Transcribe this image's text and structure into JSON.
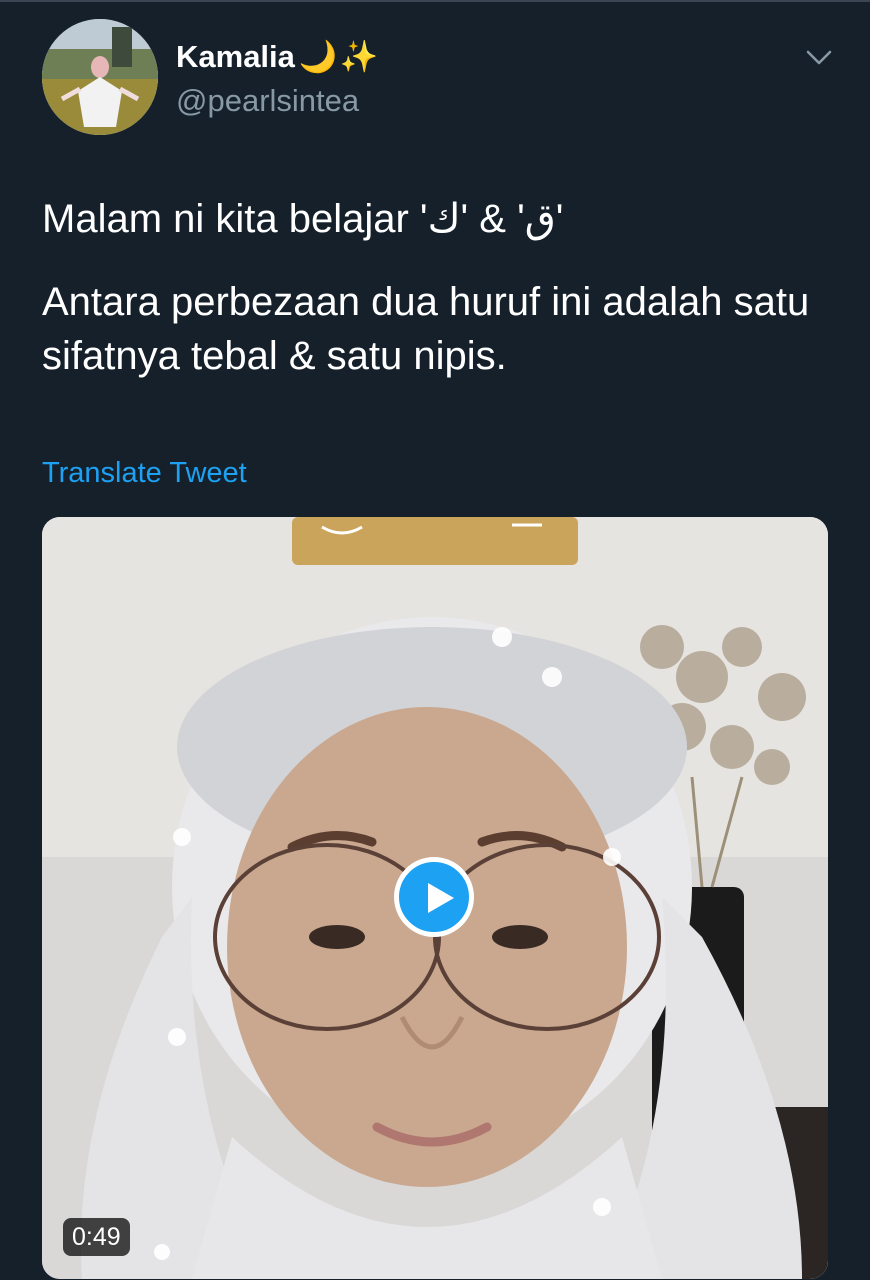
{
  "tweet": {
    "author": {
      "display_name": "Kamalia",
      "name_emoji_moon": "🌙",
      "name_emoji_sparkles": "✨",
      "handle": "@pearlsintea"
    },
    "text_line1": "Malam ni kita belajar 'ق' & 'ك'",
    "text_line2": "Antara perbezaan dua huruf ini adalah satu sifatnya tebal & satu nipis.",
    "translate_label": "Translate Tweet",
    "media": {
      "type": "video",
      "duration": "0:49"
    }
  },
  "icons": {
    "menu": "chevron-down-icon",
    "play": "play-icon"
  },
  "colors": {
    "background": "#15202b",
    "link": "#1da1f2",
    "secondary_text": "#8899a6"
  }
}
